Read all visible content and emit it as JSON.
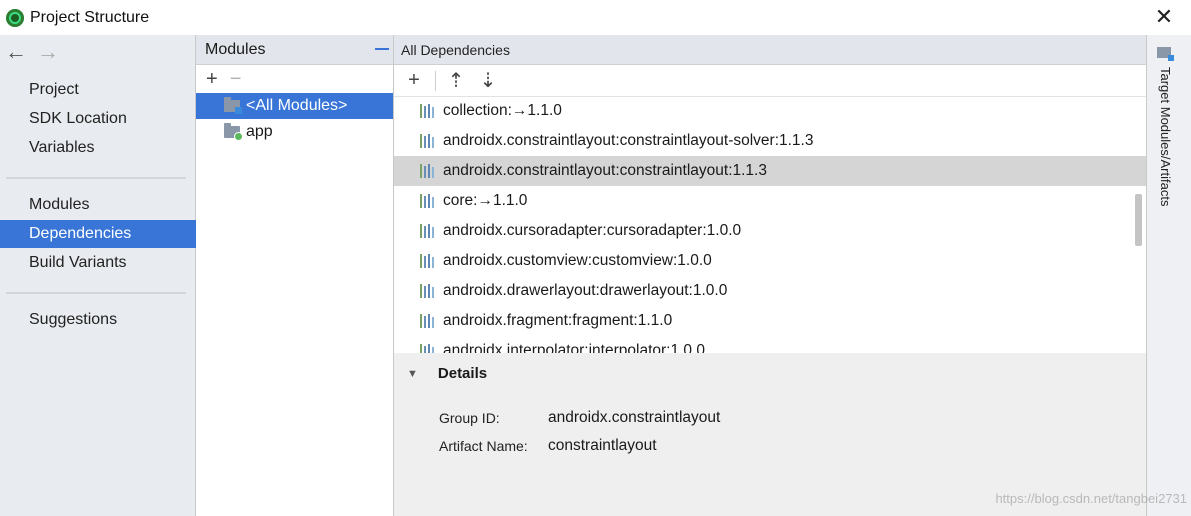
{
  "window": {
    "title": "Project Structure",
    "close_glyph": "✕",
    "icon": "android-studio-icon"
  },
  "nav": {
    "back_glyph": "←",
    "forward_glyph": "→",
    "items": [
      {
        "label": "Project"
      },
      {
        "label": "SDK Location"
      },
      {
        "label": "Variables"
      },
      {
        "label": "Modules"
      },
      {
        "label": "Dependencies",
        "selected": true
      },
      {
        "label": "Build Variants"
      },
      {
        "label": "Suggestions"
      }
    ]
  },
  "modules_panel": {
    "header": "Modules",
    "add_glyph": "+",
    "remove_glyph": "−",
    "items": [
      {
        "label": "<All Modules>",
        "selected": true
      },
      {
        "label": "app"
      }
    ]
  },
  "dependencies_panel": {
    "header": "All Dependencies",
    "toolbar": {
      "add_glyph": "+",
      "expand_glyph": "⇡",
      "collapse_glyph": "⇣"
    },
    "items": [
      "collection:→1.1.0",
      "androidx.constraintlayout:constraintlayout-solver:1.1.3",
      "androidx.constraintlayout:constraintlayout:1.1.3",
      "core:→1.1.0",
      "androidx.cursoradapter:cursoradapter:1.0.0",
      "androidx.customview:customview:1.0.0",
      "androidx.drawerlayout:drawerlayout:1.0.0",
      "androidx.fragment:fragment:1.1.0",
      "androidx.interpolator:interpolator:1.0.0"
    ],
    "selected_index": 2
  },
  "details": {
    "title": "Details",
    "toggle_glyph": "▼",
    "group_id_label": "Group ID:",
    "group_id_value": "androidx.constraintlayout",
    "artifact_label": "Artifact Name:",
    "artifact_value": "constraintlayout"
  },
  "right_tool": {
    "label": "Target Modules/Artifacts"
  },
  "watermark": "https://blog.csdn.net/tangbei2731",
  "colors": {
    "selection": "#3875d7",
    "row_highlight": "#d5d5d5",
    "panel_header": "#e2e6ec"
  }
}
